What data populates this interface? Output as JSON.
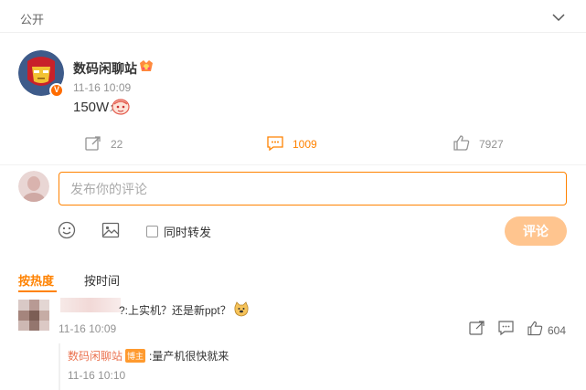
{
  "top_bar": {
    "visibility": "公开"
  },
  "post": {
    "author": "数码闲聊站",
    "time": "11-16 10:09",
    "text": "150W⚡",
    "actions": {
      "repost": "22",
      "comment": "1009",
      "like": "7927"
    }
  },
  "composer": {
    "placeholder": "发布你的评论",
    "repost_option": "同时转发",
    "submit": "评论"
  },
  "sort_tabs": {
    "hot": "按热度",
    "time": "按时间"
  },
  "comments": [
    {
      "text": "?:上实机？还是新ppt？",
      "time": "11-16 10:09",
      "likes": "604",
      "reply": {
        "author": "数码闲聊站",
        "badge": "博主",
        "text": ":量产机很快就来",
        "time": "11-16 10:10"
      }
    }
  ],
  "colors": {
    "accent": "#ff8200",
    "muted": "#939393",
    "reply_author": "#eb7350"
  }
}
